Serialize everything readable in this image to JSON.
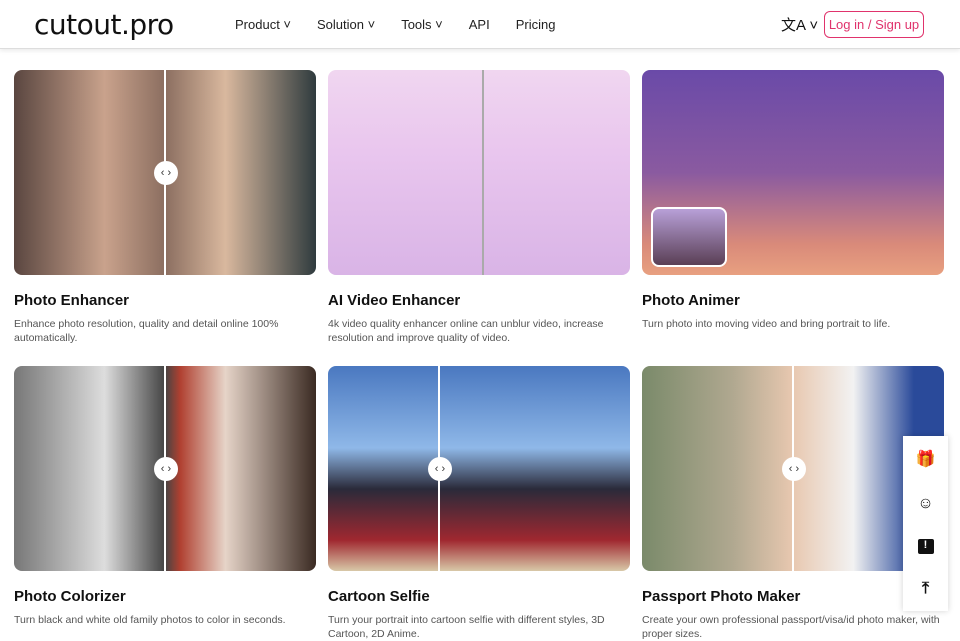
{
  "header": {
    "logo": "cutout.pro",
    "menu": [
      {
        "label": "Product ˅"
      },
      {
        "label": "Solution ˅"
      },
      {
        "label": "Tools ˅"
      },
      {
        "label": "API"
      },
      {
        "label": "Pricing"
      }
    ],
    "language_icon": "文A ˅",
    "login": "Log in / Sign up"
  },
  "cards": [
    {
      "title": "Photo Enhancer",
      "desc": "Enhance photo resolution, quality and detail online 100% automatically."
    },
    {
      "title": "AI Video Enhancer",
      "desc": "4k video quality enhancer online can unblur video, increase resolution and improve quality of video."
    },
    {
      "title": "Photo Animer",
      "desc": "Turn photo into moving video and bring portrait to life."
    },
    {
      "title": "Photo Colorizer",
      "desc": "Turn black and white old family photos to color in seconds."
    },
    {
      "title": "Cartoon Selfie",
      "desc": "Turn your portrait into cartoon selfie with different styles, 3D Cartoon, 2D Anime."
    },
    {
      "title": "Passport Photo Maker",
      "desc": "Create your own professional passport/visa/id photo maker, with proper sizes."
    }
  ],
  "handle": "‹ ›",
  "side_icons": [
    "gift-icon",
    "support-icon",
    "feedback-icon",
    "back-to-top-icon"
  ]
}
